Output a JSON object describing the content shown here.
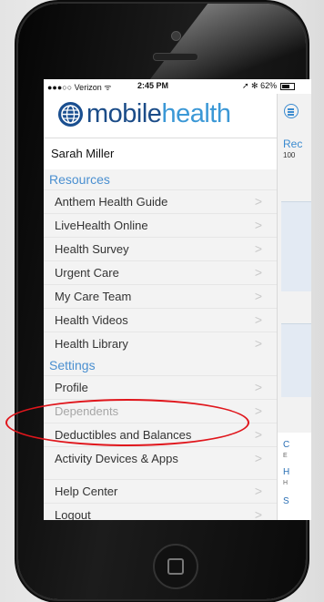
{
  "status_bar": {
    "carrier": "●●●○○ Verizon ᯤ",
    "time": "2:45 PM",
    "right": "➚ ✻ 62%"
  },
  "app": {
    "logo_mobile": "mobile",
    "logo_health": "health"
  },
  "user": {
    "name": "Sarah Miller"
  },
  "menu": {
    "resources_heading": "Resources",
    "resources": [
      "Anthem Health Guide",
      "LiveHealth Online",
      "Health Survey",
      "Urgent Care",
      "My Care Team",
      "Health Videos",
      "Health Library"
    ],
    "settings_heading": "Settings",
    "settings": [
      "Profile",
      "Dependents",
      "Deductibles and Balances",
      "Activity Devices & Apps"
    ],
    "footer": [
      "Help Center",
      "Logout"
    ],
    "chevron": ">"
  },
  "right_panel": {
    "heading": "Rec",
    "sub": "100",
    "letters": [
      "C",
      "E",
      "H",
      "H",
      "S"
    ]
  },
  "annotation": {
    "color": "#e0161c"
  },
  "colors": {
    "accent": "#3b98d6",
    "brand": "#1b4c88"
  }
}
